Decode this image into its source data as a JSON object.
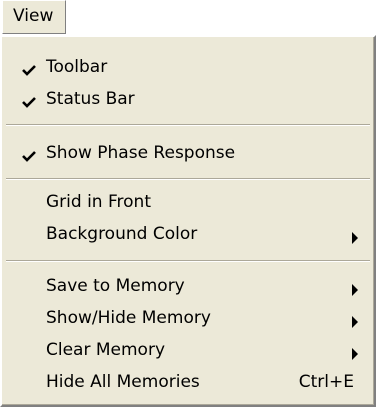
{
  "menu": {
    "title": "View",
    "items": [
      {
        "label": "Toolbar",
        "checked": true
      },
      {
        "label": "Status Bar",
        "checked": true
      },
      {
        "label": "Show Phase Response",
        "checked": true
      },
      {
        "label": "Grid in Front"
      },
      {
        "label": "Background Color",
        "submenu": true
      },
      {
        "label": "Save to Memory",
        "submenu": true
      },
      {
        "label": "Show/Hide Memory",
        "submenu": true
      },
      {
        "label": "Clear Memory",
        "submenu": true
      },
      {
        "label": "Hide All Memories",
        "shortcut": "Ctrl+E"
      }
    ]
  },
  "icons": {
    "check": "checkmark-icon",
    "submenu": "submenu-arrow-icon"
  }
}
